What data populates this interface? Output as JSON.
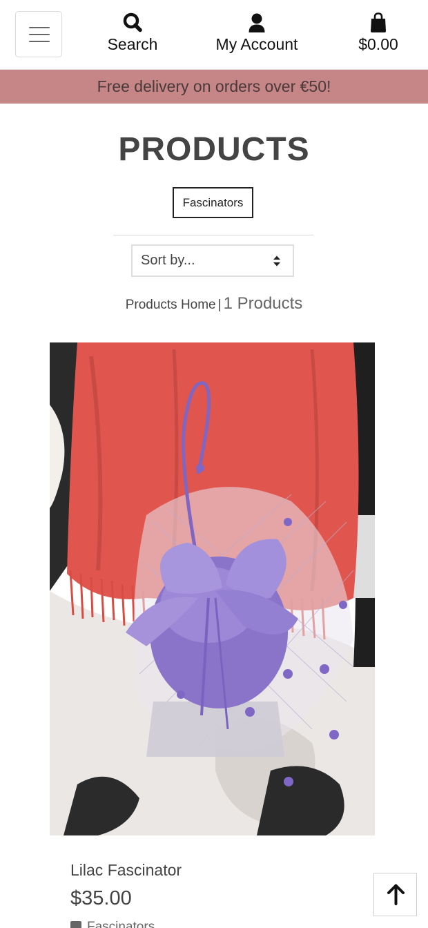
{
  "nav": {
    "search_label": "Search",
    "account_label": "My Account",
    "cart_total": "$0.00",
    "icons": [
      "menu-icon",
      "search-icon",
      "user-icon",
      "shopping-bag-icon"
    ]
  },
  "banner": {
    "text": "Free delivery on orders over €50!"
  },
  "page": {
    "title": "PRODUCTS",
    "category_tag": "Fascinators",
    "sort_label": "Sort by...",
    "breadcrumb_home": "Products Home",
    "breadcrumb_sep": "|",
    "product_count": "1 Products"
  },
  "products": [
    {
      "name": "Lilac Fascinator",
      "price": "$35.00",
      "category": "Fascinators"
    }
  ],
  "colors": {
    "banner_bg": "#c68586",
    "text_dark": "#444444",
    "accent_lilac": "#8a74c9"
  }
}
